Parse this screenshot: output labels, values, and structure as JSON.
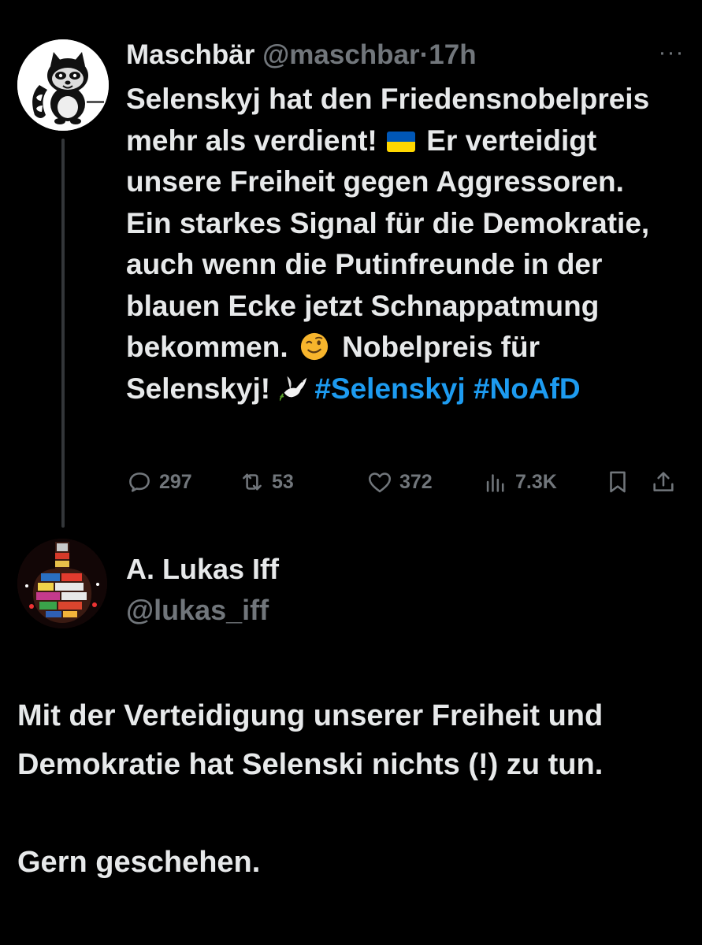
{
  "tweet": {
    "author_name": "Maschbär",
    "author_handle": "@maschbar",
    "separator": "·",
    "time": "17h",
    "more_label": "···",
    "text_part1": "Selenskyj hat den Friedensnobelpreis mehr als verdient! ",
    "flag_emoji_name": "ukraine-flag",
    "text_part2": " Er verteidigt unsere Freiheit gegen Aggressoren. Ein starkes Signal für die Demokratie, auch wenn die Putinfreunde in der blauen Ecke jetzt Schnappatmung bekommen. ",
    "wink_emoji_name": "winking-face",
    "text_part3": " Nobelpreis für Selenskyj! ",
    "dove_emoji_name": "dove",
    "hashtag1": "#Selenskyj",
    "hashtag2": "#NoAfD",
    "stats": {
      "replies": "297",
      "retweets": "53",
      "likes": "372",
      "views": "7.3K"
    },
    "icons": {
      "reply": "reply-icon",
      "retweet": "retweet-icon",
      "like": "heart-icon",
      "views": "views-icon",
      "bookmark": "bookmark-icon",
      "share": "share-icon"
    }
  },
  "reply": {
    "author_name": "A. Lukas Iff",
    "author_handle": "@lukas_iff",
    "text_line1": "Mit der Verteidigung unserer Freiheit und Demokratie hat Selenski nichts (!) zu tun.",
    "text_line2": "Gern geschehen."
  },
  "colors": {
    "background": "#000000",
    "text": "#e7e9ea",
    "muted": "#71767b",
    "link": "#1d9bf0",
    "thread_line": "#333639"
  }
}
